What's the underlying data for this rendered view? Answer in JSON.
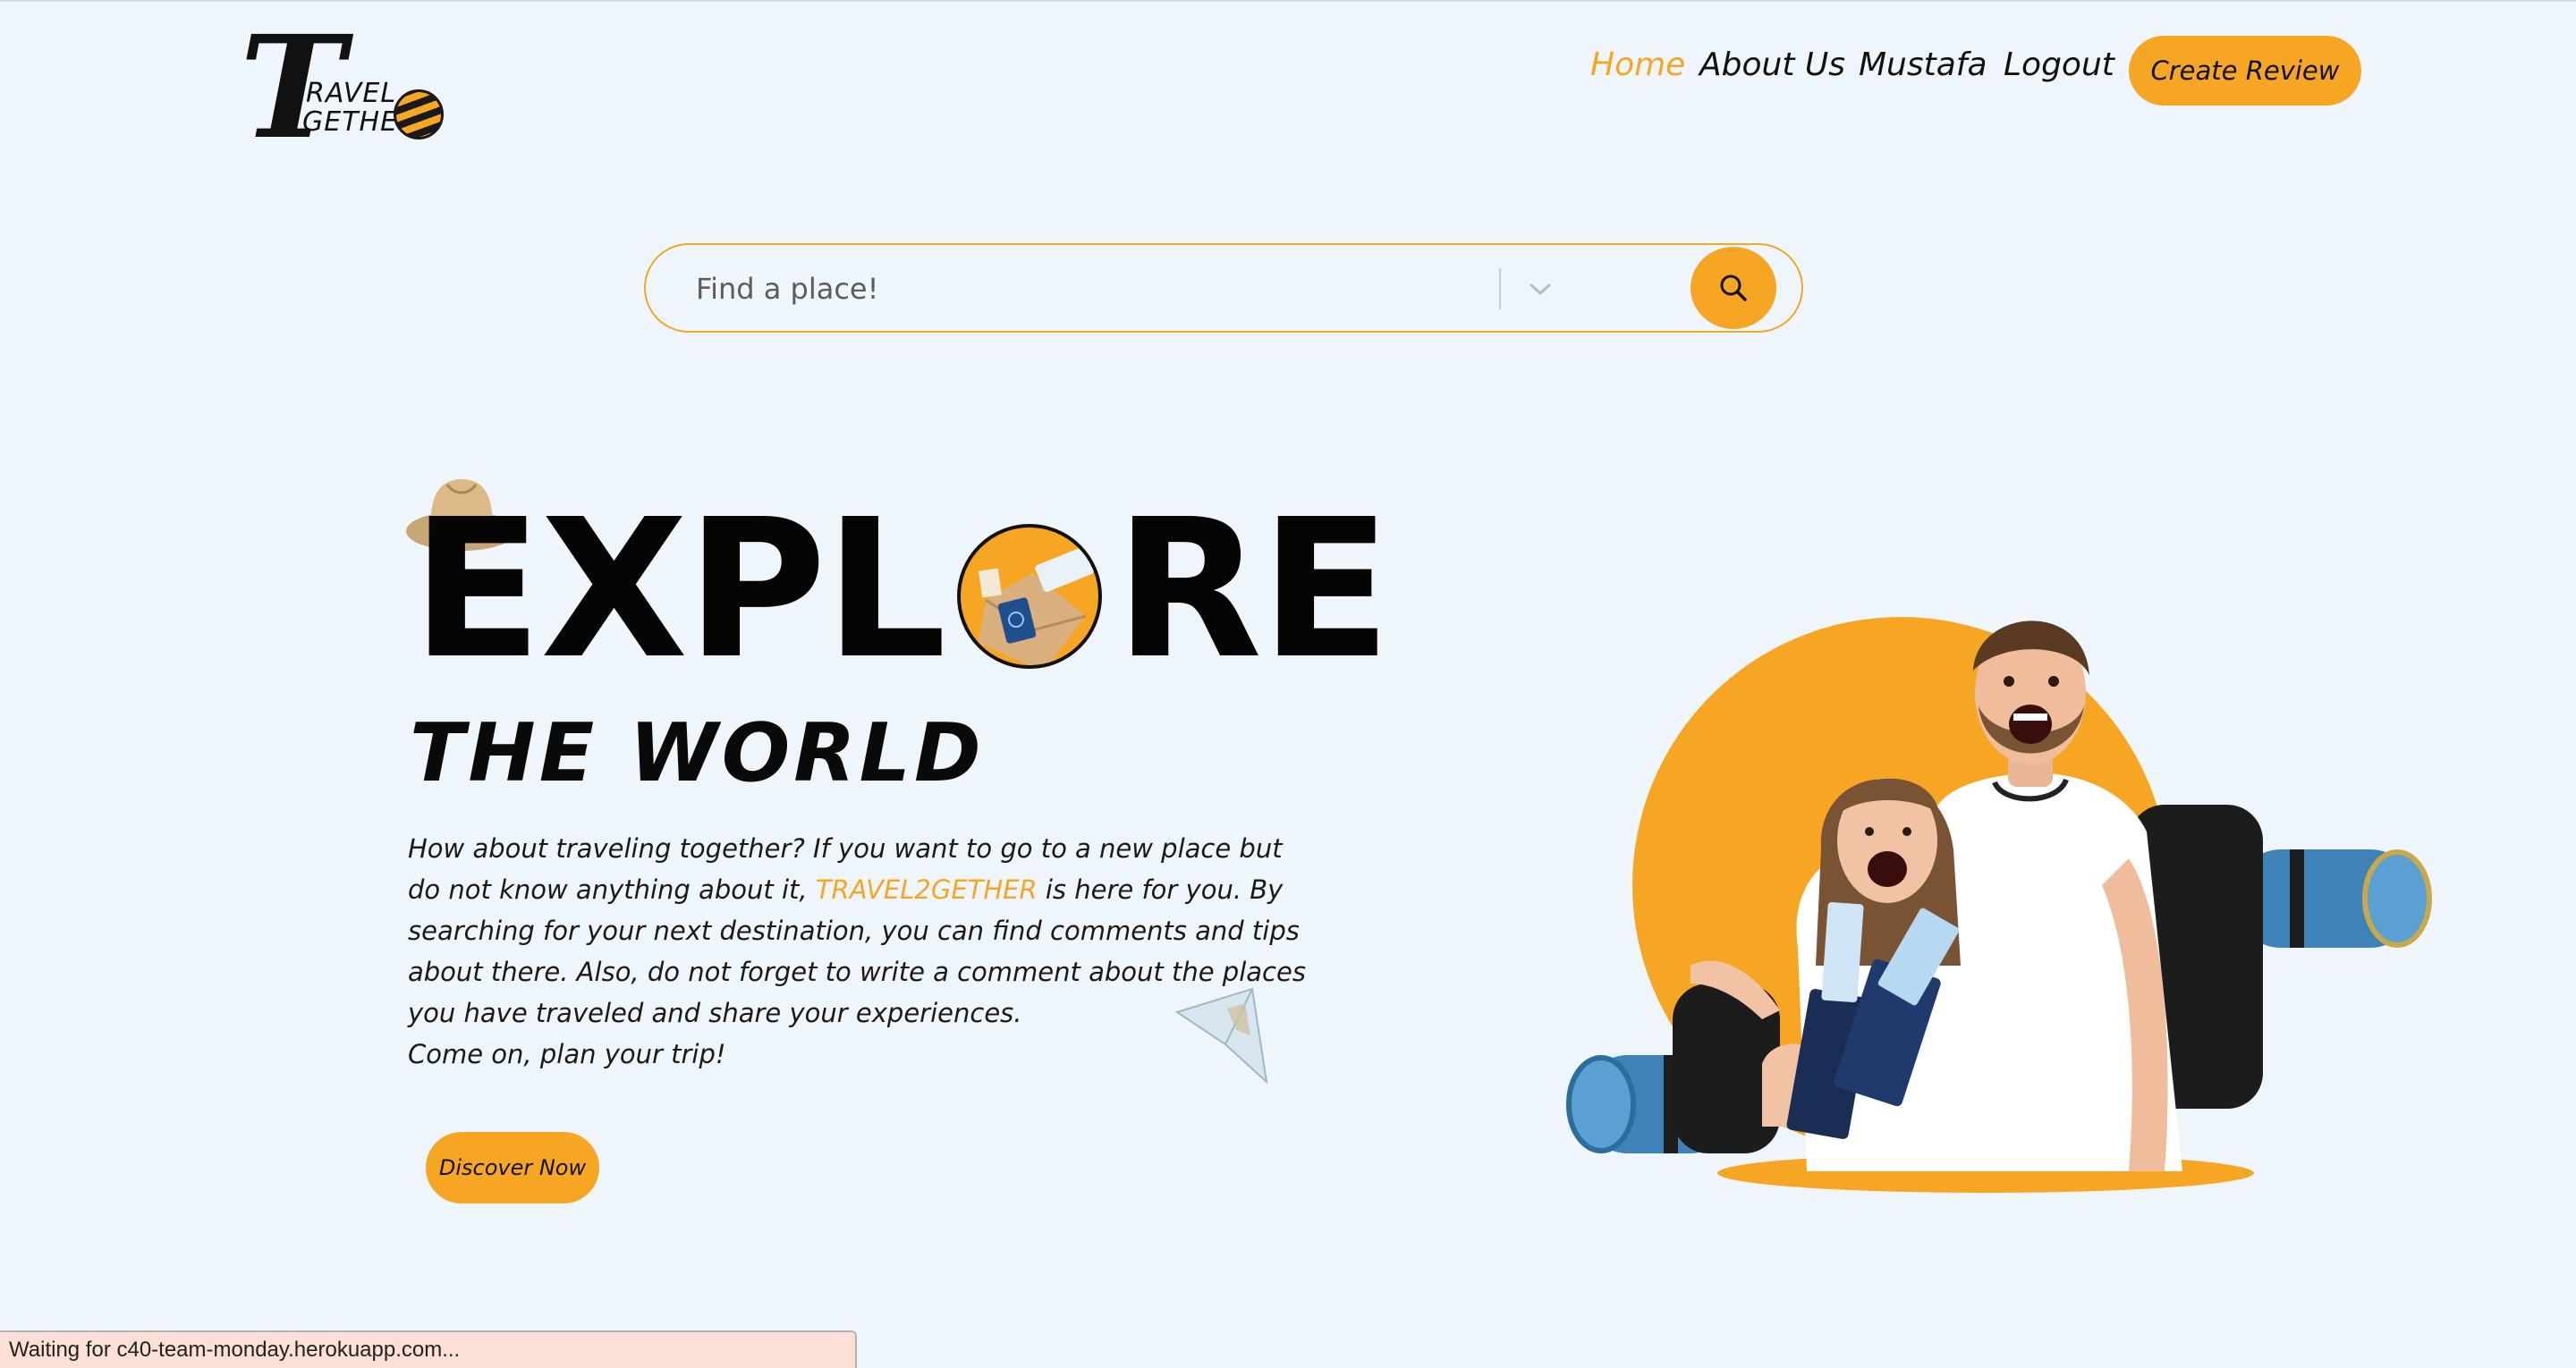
{
  "logo": {
    "letter": "T",
    "line1": "RAVEL",
    "line2": "GETHE"
  },
  "nav": {
    "items": [
      {
        "label": "Home",
        "active": true
      },
      {
        "label": "About Us",
        "active": false
      },
      {
        "label": "Mustafa",
        "active": false
      },
      {
        "label": "Logout",
        "active": false
      }
    ],
    "cta_label": "Create Review"
  },
  "search": {
    "placeholder": "Find a place!",
    "button_icon": "search-icon",
    "dropdown_icon": "chevron-down-icon"
  },
  "hero": {
    "explore_before": "EXPL",
    "explore_after": "RE",
    "subtitle": "THE WORLD",
    "desc_part1": "How about traveling together? If you want to go to a new place but do not know anything about it, ",
    "brand": "TRAVEL2GETHER",
    "desc_part2": " is here for you. By searching for your next destination, you can find comments and tips about there. Also, do not forget to write a comment about the places you have traveled and share your experiences.",
    "desc_line2": "Come on, plan your trip!",
    "button_label": "Discover Now"
  },
  "status": {
    "text": "Waiting for c40-team-monday.herokuapp.com..."
  },
  "colors": {
    "accent": "#f6a623",
    "background": "#eef6fb",
    "text": "#111111"
  }
}
